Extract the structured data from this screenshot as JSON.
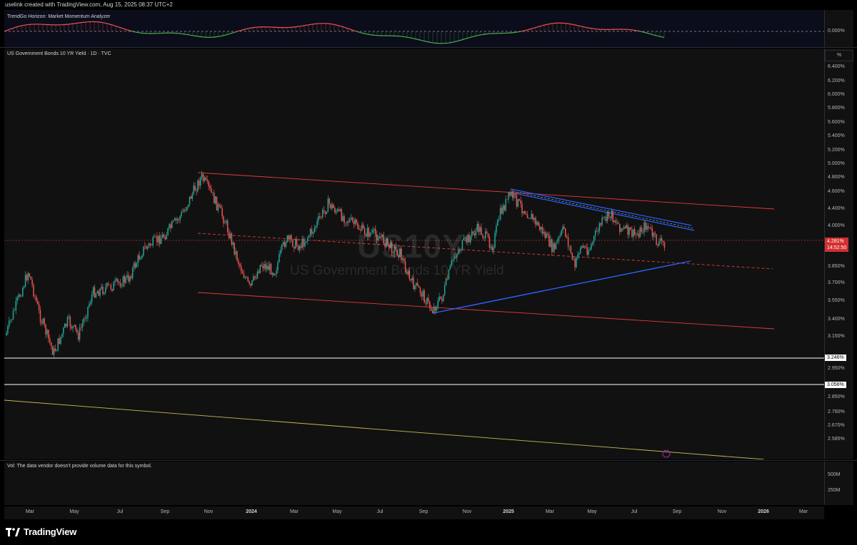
{
  "header": {
    "credit": "uselink created with TradingView.com, Aug 15, 2025 08:37 UTC+2"
  },
  "oscillator": {
    "title": "TrendGo Horizon: Market Momentum Analyzer",
    "zero_label": "0.000%"
  },
  "chart": {
    "symbol_line": "US Government Bonds 10 YR Yield · 1D · TVC",
    "watermark_ticker": "US10Y",
    "watermark_name": "US Government Bonds 10 YR Yield",
    "unit_button": "%",
    "price_ticks": [
      "6.400%",
      "6.200%",
      "6.000%",
      "5.800%",
      "5.600%",
      "5.400%",
      "5.200%",
      "5.000%",
      "4.800%",
      "4.600%",
      "4.400%",
      "4.000%",
      "3.850%",
      "3.700%",
      "3.550%",
      "3.400%",
      "3.150%",
      "2.950%",
      "2.850%",
      "2.760%",
      "2.670%",
      "2.585%"
    ],
    "last_price": "4.281%",
    "countdown": "14:52:50",
    "level_label_1": "3.246%",
    "level_label_2": "3.056%",
    "colors": {
      "up": "#26a69a",
      "down": "#ef5350",
      "channel": "#e03a3a",
      "support": "#2962ff",
      "resistance": "#2962ff",
      "yellow": "#c6b85a"
    }
  },
  "volume": {
    "note": "Vol: The data vendor doesn't provide volume data for this symbol.",
    "ticks": [
      "500M",
      "250M"
    ]
  },
  "time_axis": {
    "labels": [
      "Mar",
      "May",
      "Jul",
      "Sep",
      "Nov",
      "2024",
      "Mar",
      "May",
      "Jul",
      "Sep",
      "Nov",
      "2025",
      "Mar",
      "May",
      "Jul",
      "Sep",
      "Nov",
      "2026",
      "Mar"
    ]
  },
  "footer": {
    "brand": "TradingView",
    "logo_icon": "tradingview-logo-icon"
  }
}
